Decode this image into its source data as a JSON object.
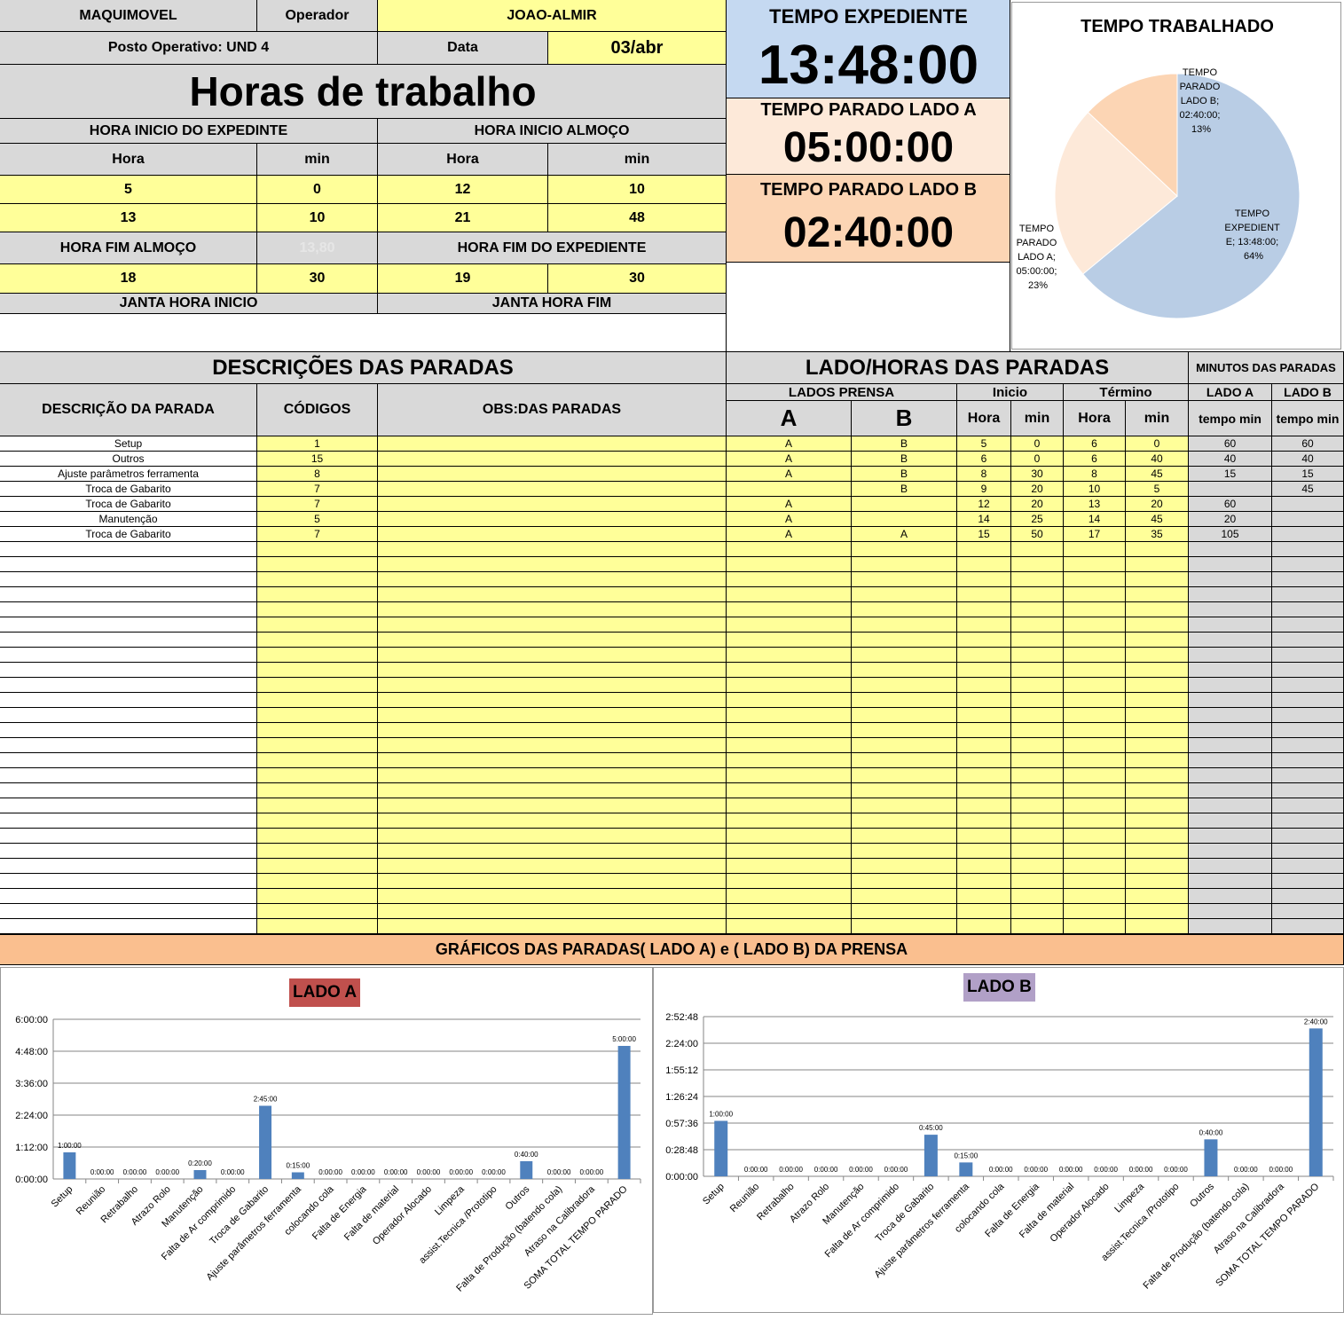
{
  "header": {
    "company": "MAQUIMOVEL",
    "operator_label": "Operador",
    "operator_value": "JOAO-ALMIR",
    "posto": "Posto Operativo: UND 4",
    "date_label": "Data",
    "date_value": "03/abr",
    "title": "Horas de trabalho"
  },
  "timers": {
    "expediente_label": "TEMPO EXPEDIENTE",
    "expediente_value": "13:48:00",
    "lado_a_label": "TEMPO PARADO LADO A",
    "lado_a_value": "05:00:00",
    "lado_b_label": "TEMPO PARADO LADO B",
    "lado_b_value": "02:40:00"
  },
  "hours": {
    "inicio_expediente_label": "HORA INICIO DO EXPEDINTE",
    "inicio_almoco_label": "HORA INICIO ALMOÇO",
    "hora_label": "Hora",
    "min_label": "min",
    "row1": [
      "5",
      "0",
      "12",
      "10"
    ],
    "row2": [
      "13",
      "10",
      "21",
      "48"
    ],
    "fim_almoco_label": "HORA FIM ALMOÇO",
    "fim_almoco_ghost": "13,80",
    "fim_expediente_label": "HORA FIM DO EXPEDIENTE",
    "row3": [
      "18",
      "30",
      "19",
      "30"
    ],
    "janta_inicio_label": "JANTA HORA INICIO",
    "janta_fim_label": "JANTA HORA FIM"
  },
  "pie": {
    "title": "TEMPO TRABALHADO",
    "labels": {
      "expediente": [
        "TEMPO",
        "EXPEDIENT",
        "E; 13:48:00;",
        "64%"
      ],
      "lado_a": [
        "TEMPO",
        "PARADO",
        "LADO A;",
        "05:00:00;",
        "23%"
      ],
      "lado_b": [
        "TEMPO",
        "PARADO",
        "LADO B;",
        "02:40:00;",
        "13%"
      ]
    },
    "colors": {
      "expediente": "#b9cde5",
      "lado_a": "#fde9d9",
      "lado_b": "#fcd5b4"
    }
  },
  "chart_data_pie": {
    "type": "pie",
    "title": "TEMPO TRABALHADO",
    "categories": [
      "TEMPO EXPEDIENTE",
      "TEMPO PARADO LADO A",
      "TEMPO PARADO LADO B"
    ],
    "values": [
      64,
      23,
      13
    ]
  },
  "stops": {
    "section_title": "DESCRIÇÕES DAS PARADAS",
    "lado_horas_title": "LADO/HORAS DAS PARADAS",
    "minutos_title": "MINUTOS DAS PARADAS",
    "col_descricao": "DESCRIÇÃO DA PARADA",
    "col_codigos": "CÓDIGOS",
    "col_obs": "OBS:DAS PARADAS",
    "col_lados_prensa": "LADOS PRENSA",
    "col_a": "A",
    "col_b": "B",
    "col_inicio": "Inicio",
    "col_termino": "Término",
    "col_hora": "Hora",
    "col_min": "min",
    "col_lado_a": "LADO A",
    "col_lado_b": "LADO B",
    "col_tempo_min": "tempo min",
    "rows": [
      [
        "Setup",
        "1",
        "",
        "A",
        "B",
        "5",
        "0",
        "6",
        "0",
        "60",
        "60"
      ],
      [
        "Outros",
        "15",
        "",
        "A",
        "B",
        "6",
        "0",
        "6",
        "40",
        "40",
        "40"
      ],
      [
        "Ajuste parâmetros ferramenta",
        "8",
        "",
        "A",
        "B",
        "8",
        "30",
        "8",
        "45",
        "15",
        "15"
      ],
      [
        "Troca de Gabarito",
        "7",
        "",
        "",
        "B",
        "9",
        "20",
        "10",
        "5",
        "",
        "45"
      ],
      [
        "Troca de Gabarito",
        "7",
        "",
        "A",
        "",
        "12",
        "20",
        "13",
        "20",
        "60",
        ""
      ],
      [
        "Manutenção",
        "5",
        "",
        "A",
        "",
        "14",
        "25",
        "14",
        "45",
        "20",
        ""
      ],
      [
        "Troca de Gabarito",
        "7",
        "",
        "A",
        "A",
        "15",
        "50",
        "17",
        "35",
        "105",
        ""
      ]
    ],
    "empty_rows": 26
  },
  "charts_banner": "GRÁFICOS DAS PARADAS( LADO A) e ( LADO B) DA PRENSA",
  "chart_data": [
    {
      "type": "bar",
      "title": "LADO A",
      "categories": [
        "Setup",
        "Reunião",
        "Retrabalho",
        "Atrazo Rolo",
        "Manutenção",
        "Falta de Ar comprimido",
        "Troca de Gabarito",
        "Ajuste parâmetros ferramenta",
        "colocando cola",
        "Falta de Energia",
        "Falta de material",
        "Operador Alocado",
        "Limpeza",
        "assist.Tecnica /Prototipo",
        "Outros",
        "Falta de Produção (batendo cola)",
        "Atraso na Calibradora",
        "SOMA TOTAL TEMPO PARADO"
      ],
      "values": [
        60,
        0,
        0,
        0,
        20,
        0,
        165,
        15,
        0,
        0,
        0,
        0,
        0,
        0,
        40,
        0,
        0,
        300
      ],
      "data_labels": [
        "1:00:00",
        "0:00:00",
        "0:00:00",
        "0:00:00",
        "0:20:00",
        "0:00:00",
        "2:45:00",
        "0:15:00",
        "0:00:00",
        "0:00:00",
        "0:00:00",
        "0:00:00",
        "0:00:00",
        "0:00:00",
        "0:40:00",
        "0:00:00",
        "0:00:00",
        "5:00:00"
      ],
      "ylim": [
        0,
        360
      ],
      "yticks": [
        "0:00:00",
        "1:12:00",
        "2:24:00",
        "3:36:00",
        "4:48:00",
        "6:00:00"
      ],
      "ytick_values": [
        0,
        72,
        144,
        216,
        288,
        360
      ],
      "title_bg": "#c0504d",
      "bar_color": "#4f81bd"
    },
    {
      "type": "bar",
      "title": "LADO B",
      "categories": [
        "Setup",
        "Reunião",
        "Retrabalho",
        "Atrazo Rolo",
        "Manutenção",
        "Falta de Ar comprimido",
        "Troca de Gabarito",
        "Ajuste parâmetros ferramenta",
        "colocando cola",
        "Falta de Energia",
        "Falta de material",
        "Operador Alocado",
        "Limpeza",
        "assist.Tecnica /Prototipo",
        "Outros",
        "Falta de Produção (batendo cola)",
        "Atraso na Calibradora",
        "SOMA TOTAL TEMPO PARADO"
      ],
      "values": [
        60,
        0,
        0,
        0,
        0,
        0,
        45,
        15,
        0,
        0,
        0,
        0,
        0,
        0,
        40,
        0,
        0,
        160
      ],
      "data_labels": [
        "1:00:00",
        "0:00:00",
        "0:00:00",
        "0:00:00",
        "0:00:00",
        "0:00:00",
        "0:45:00",
        "0:15:00",
        "0:00:00",
        "0:00:00",
        "0:00:00",
        "0:00:00",
        "0:00:00",
        "0:00:00",
        "0:40:00",
        "0:00:00",
        "0:00:00",
        "2:40:00"
      ],
      "ylim": [
        0,
        172.8
      ],
      "yticks": [
        "0:00:00",
        "0:28:48",
        "0:57:36",
        "1:26:24",
        "1:55:12",
        "2:24:00",
        "2:52:48"
      ],
      "ytick_values": [
        0,
        28.8,
        57.6,
        86.4,
        115.2,
        144,
        172.8
      ],
      "title_bg": "#b1a0c7",
      "bar_color": "#4f81bd"
    }
  ]
}
